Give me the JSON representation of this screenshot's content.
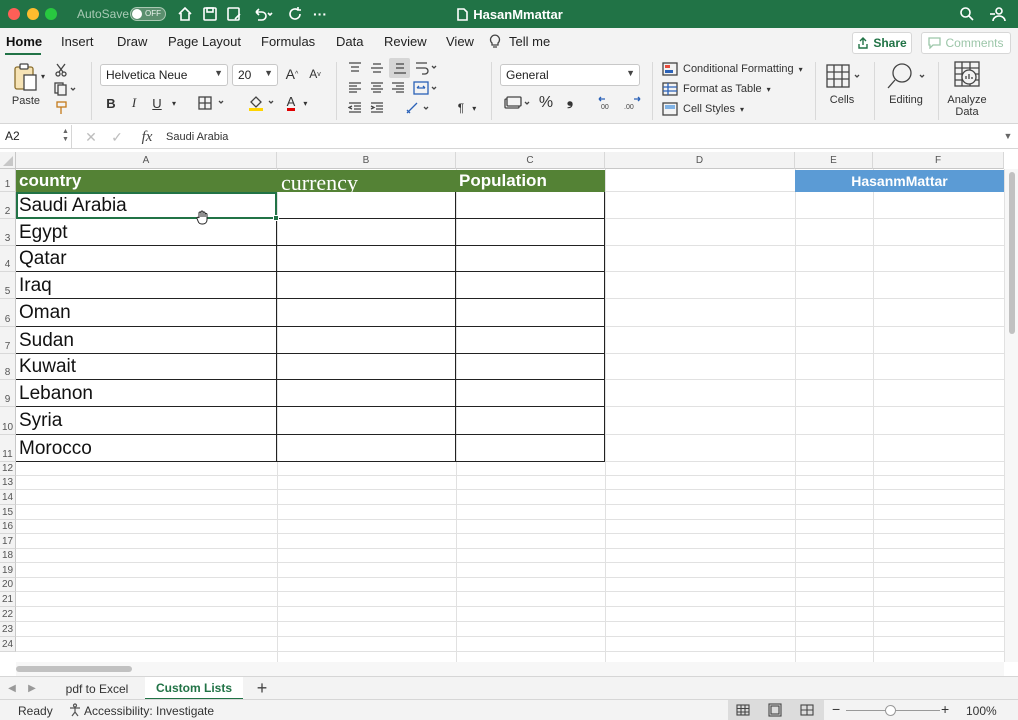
{
  "titlebar": {
    "autosave_label": "AutoSave",
    "toggle_label": "OFF",
    "doc_title": "HasanMmattar",
    "more": "···"
  },
  "tabs": [
    "Home",
    "Insert",
    "Draw",
    "Page Layout",
    "Formulas",
    "Data",
    "Review",
    "View",
    "Tell me"
  ],
  "buttons": {
    "share": "Share",
    "comments": "Comments"
  },
  "ribbon": {
    "paste": "Paste",
    "font_name": "Helvetica Neue",
    "font_size": "20",
    "number_format": "General",
    "bold": "B",
    "italic": "I",
    "underline": "U",
    "percent": "%",
    "comma": "❟",
    "conditional": "Conditional Formatting",
    "format_table": "Format as Table",
    "cell_styles": "Cell Styles",
    "cells": "Cells",
    "editing": "Editing",
    "analyze1": "Analyze",
    "analyze2": "Data",
    "inc_font": "A",
    "dec_font": "A",
    "font_color": "A"
  },
  "formula": {
    "name_box": "A2",
    "fx": "fx",
    "content": "Saudi Arabia"
  },
  "columns": [
    "A",
    "B",
    "C",
    "D",
    "E",
    "F"
  ],
  "rows": [
    "1",
    "2",
    "3",
    "4",
    "5",
    "6",
    "7",
    "8",
    "9",
    "10",
    "11",
    "12",
    "13",
    "14",
    "15",
    "16",
    "17",
    "18",
    "19",
    "20",
    "21",
    "22",
    "23",
    "24"
  ],
  "headers": {
    "a": "country",
    "b": "currency",
    "c": "Population",
    "ef": "HasanmMattar"
  },
  "countries": [
    "Saudi Arabia",
    "Egypt",
    "Qatar",
    "Iraq",
    "Oman",
    "Sudan",
    "Kuwait",
    "Lebanon",
    "Syria",
    "Morocco"
  ],
  "sheets": {
    "sheet1": "pdf to Excel",
    "sheet2": "Custom Lists",
    "add": "+"
  },
  "status": {
    "ready": "Ready",
    "accessibility": "Accessibility: Investigate",
    "zoom": "100%",
    "minus": "−",
    "plus": "+"
  },
  "colors": {
    "accent": "#217346",
    "header_green": "#548235",
    "header_blue": "#5b9bd5"
  }
}
